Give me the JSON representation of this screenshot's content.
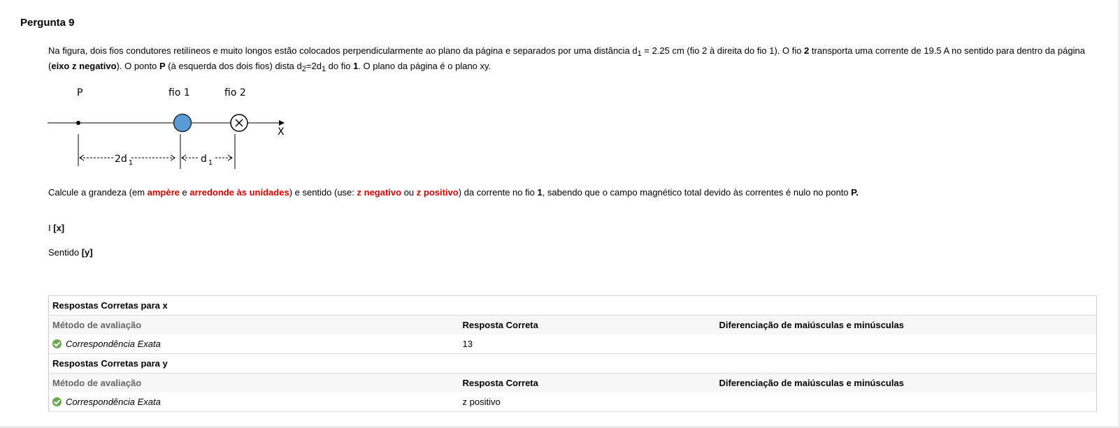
{
  "question": {
    "title": "Pergunta 9",
    "p1": {
      "s1": "Na figura, dois fios condutores retilíneos e muito longos estão colocados perpendicularmente ao plano da página e separados por uma distância d",
      "sub1": "1",
      "s2": " = 2.25 cm (fio 2 à direita do fio 1). O fio ",
      "b1": "2",
      "s3": " transporta uma corrente de 19.5 A no sentido para dentro da página (",
      "b2": "eixo z negativo",
      "s4": "). O ponto ",
      "b3": "P",
      "s5": " (à esquerda dos dois fios) dista d",
      "sub2": "2",
      "s6": "=2d",
      "sub3": "1",
      "s7": "  do fio ",
      "b4": "1",
      "s8": ". O plano da página é o plano xy."
    },
    "diagram": {
      "label_p": "P",
      "label_fio1": "fio 1",
      "label_fio2": "fio 2",
      "label_x": "X",
      "dist1": "2d",
      "dist1_sub": "1",
      "dist2": "d",
      "dist2_sub": "1"
    },
    "p2": {
      "s1": "Calcule a grandeza (em ",
      "r1": "ampère",
      "s2": " e ",
      "r2": "arredonde às unidades",
      "s3": ")  e sentido (use: ",
      "r3": "z negativo",
      "s4": " ou ",
      "r4": "z positivo",
      "s5": ") da corrente no fio ",
      "b1": "1",
      "s6": ", sabendo que o campo magnético total devido às correntes é nulo no ponto ",
      "b2": "P."
    },
    "line_i": {
      "label": "I ",
      "var": "[x]"
    },
    "line_s": {
      "label": "Sentido ",
      "var": "[y]"
    }
  },
  "answers": [
    {
      "section_title": "Respostas Corretas para x",
      "col_method": "Método de avaliação",
      "col_answer": "Resposta Correta",
      "col_case": "Diferenciação de maiúsculas e minúsculas",
      "method": "Correspondência Exata",
      "answer": "13",
      "case": ""
    },
    {
      "section_title": "Respostas Corretas para y",
      "col_method": "Método de avaliação",
      "col_answer": "Resposta Correta",
      "col_case": "Diferenciação de maiúsculas e minúsculas",
      "method": "Correspondência Exata",
      "answer": "z positivo",
      "case": ""
    }
  ],
  "colors": {
    "wire1": "#5b9bd5",
    "highlight_red": "#e00000",
    "check_green": "#6aa84f"
  }
}
